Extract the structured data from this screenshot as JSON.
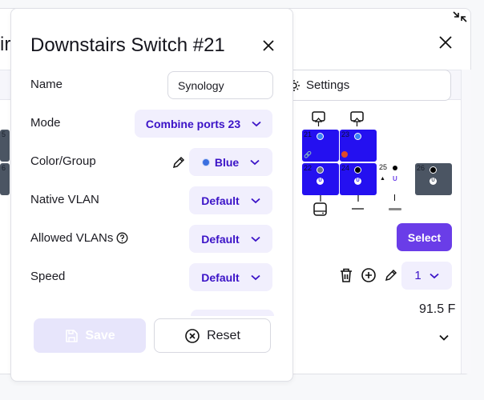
{
  "background": {
    "title_fragment": "ir",
    "settings_label": "Settings",
    "select_label": "Select",
    "page_select_value": "1",
    "temperature": "91.5 F",
    "ports": [
      {
        "num": "5",
        "color": "gray"
      },
      {
        "num": "6",
        "color": "gray"
      },
      {
        "num": "21",
        "color": "blue",
        "led": "blue",
        "icon": "link"
      },
      {
        "num": "23",
        "color": "blue",
        "led": "blue",
        "status": "red"
      },
      {
        "num": "22",
        "color": "blue",
        "led": "gray",
        "uplink": "U"
      },
      {
        "num": "24",
        "color": "blue",
        "led": "black",
        "uplink": "U"
      },
      {
        "num": "25",
        "color": "none",
        "led": "black",
        "uplink": "U"
      },
      {
        "num": "26",
        "color": "gray",
        "led": "black",
        "uplink": "U"
      }
    ],
    "uplink_label": "U"
  },
  "modal": {
    "title": "Downstairs Switch #21",
    "fields": {
      "name": {
        "label": "Name",
        "value": "Synology"
      },
      "mode": {
        "label": "Mode",
        "value": "Combine ports 23"
      },
      "color_group": {
        "label": "Color/Group",
        "value": "Blue",
        "dot_color": "#3b6fe0"
      },
      "native_vlan": {
        "label": "Native VLAN",
        "value": "Default"
      },
      "allowed_vlans": {
        "label": "Allowed VLANs",
        "value": "Default"
      },
      "speed": {
        "label": "Speed",
        "value": "Default"
      }
    },
    "save_label": "Save",
    "reset_label": "Reset"
  },
  "colors": {
    "accent": "#6a3de8",
    "dropdown_bg": "#f1effd",
    "dropdown_text": "#3b13c7",
    "port_blue": "#2410f0",
    "port_gray": "#4b5563"
  }
}
